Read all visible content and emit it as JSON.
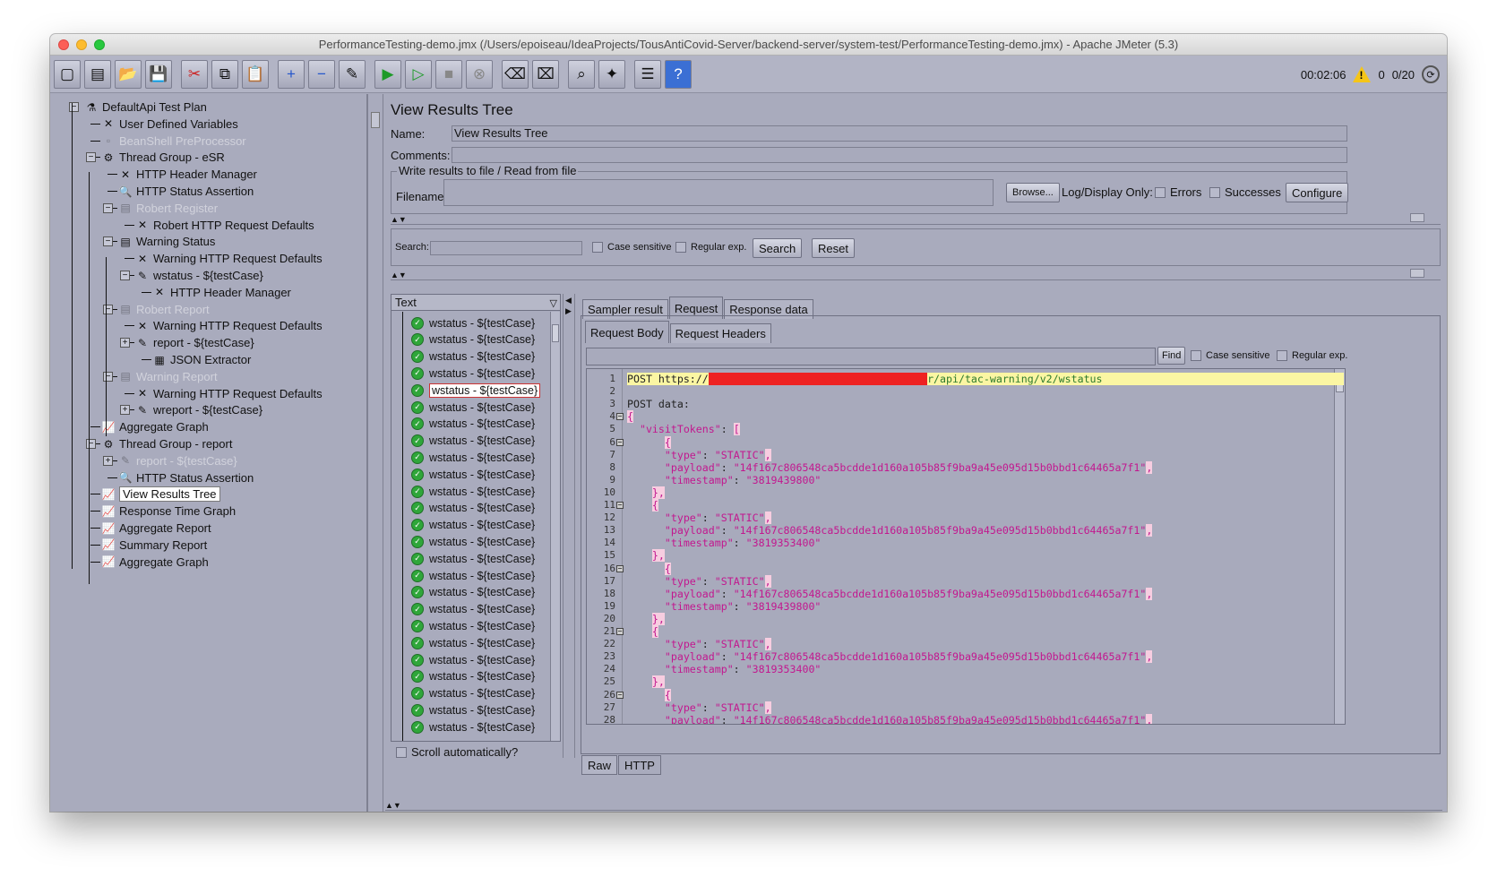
{
  "window": {
    "title": "PerformanceTesting-demo.jmx (/Users/epoiseau/IdeaProjects/TousAntiCovid-Server/backend-server/system-test/PerformanceTesting-demo.jmx) - Apache JMeter (5.3)"
  },
  "toolbar": {
    "elapsed": "00:02:06",
    "errors": "0",
    "threads": "0/20",
    "buttons": [
      "new-icon",
      "templates-icon",
      "open-icon",
      "save-icon",
      "cut-icon",
      "copy-icon",
      "paste-icon",
      "expand-icon",
      "collapse-icon",
      "toggle-icon",
      "start-icon",
      "start-no-pause-icon",
      "stop-icon",
      "shutdown-icon",
      "clear-icon",
      "clear-all-icon",
      "search-icon",
      "reset-search-icon",
      "function-helper-icon",
      "help-icon"
    ]
  },
  "tree": {
    "items": [
      {
        "label": "DefaultApi Test Plan",
        "icon": "testplan-icon",
        "disabled": false
      },
      {
        "label": "User Defined Variables",
        "icon": "config-icon",
        "disabled": false
      },
      {
        "label": "BeanShell PreProcessor",
        "icon": "preprocessor-icon",
        "disabled": true
      },
      {
        "label": "Thread Group - eSR",
        "icon": "gear-icon",
        "disabled": false
      },
      {
        "label": "HTTP Header Manager",
        "icon": "config-icon",
        "disabled": false
      },
      {
        "label": "HTTP Status Assertion",
        "icon": "assertion-icon",
        "disabled": false
      },
      {
        "label": "Robert Register",
        "icon": "controller-icon",
        "disabled": true
      },
      {
        "label": "Robert HTTP Request Defaults",
        "icon": "config-icon",
        "disabled": false
      },
      {
        "label": "Warning Status",
        "icon": "controller-icon",
        "disabled": false
      },
      {
        "label": "Warning HTTP Request Defaults",
        "icon": "config-icon",
        "disabled": false
      },
      {
        "label": "wstatus - ${testCase}",
        "icon": "sampler-icon",
        "disabled": false
      },
      {
        "label": "HTTP Header Manager",
        "icon": "config-icon",
        "disabled": false
      },
      {
        "label": "Robert Report",
        "icon": "controller-icon",
        "disabled": true
      },
      {
        "label": "Warning HTTP Request Defaults",
        "icon": "config-icon",
        "disabled": false
      },
      {
        "label": "report - ${testCase}",
        "icon": "sampler-icon",
        "disabled": false
      },
      {
        "label": "JSON Extractor",
        "icon": "extractor-icon",
        "disabled": false
      },
      {
        "label": "Warning Report",
        "icon": "controller-icon",
        "disabled": true
      },
      {
        "label": "Warning HTTP Request Defaults",
        "icon": "config-icon",
        "disabled": false
      },
      {
        "label": "wreport - ${testCase}",
        "icon": "sampler-icon",
        "disabled": false
      },
      {
        "label": "Aggregate Graph",
        "icon": "listener-icon",
        "disabled": false
      },
      {
        "label": "Thread Group - report",
        "icon": "gear-icon",
        "disabled": false
      },
      {
        "label": "report - ${testCase}",
        "icon": "sampler-icon",
        "disabled": true
      },
      {
        "label": "HTTP Status Assertion",
        "icon": "assertion-icon",
        "disabled": false
      },
      {
        "label": "View Results Tree",
        "icon": "listener-icon",
        "disabled": false,
        "selected": true
      },
      {
        "label": "Response Time Graph",
        "icon": "listener-icon",
        "disabled": false
      },
      {
        "label": "Aggregate Report",
        "icon": "listener-icon",
        "disabled": false
      },
      {
        "label": "Summary Report",
        "icon": "listener-icon",
        "disabled": false
      },
      {
        "label": "Aggregate Graph",
        "icon": "listener-icon",
        "disabled": false
      }
    ]
  },
  "panel": {
    "title": "View Results Tree",
    "name_label": "Name:",
    "name_value": "View Results Tree",
    "comments_label": "Comments:",
    "comments_value": "",
    "file_group_label": "Write results to file / Read from file",
    "filename_label": "Filename",
    "filename_value": "",
    "browse_label": "Browse...",
    "log_display_label": "Log/Display Only:",
    "errors_label": "Errors",
    "successes_label": "Successes",
    "configure_label": "Configure",
    "search_label": "Search:",
    "search_value": "",
    "case_sensitive_label": "Case sensitive",
    "regex_label": "Regular exp.",
    "search_button": "Search",
    "reset_button": "Reset"
  },
  "results": {
    "header": "Text",
    "item_label": "wstatus - ${testCase}",
    "count": 25,
    "selected_index": 4,
    "scroll_auto_label": "Scroll automatically?"
  },
  "tabs": {
    "main": [
      "Sampler result",
      "Request",
      "Response data"
    ],
    "main_active": "Request",
    "sub": [
      "Request Body",
      "Request Headers"
    ],
    "sub_active": "Request Body",
    "bottom": [
      "Raw",
      "HTTP"
    ],
    "bottom_active": "HTTP"
  },
  "request": {
    "find_button": "Find",
    "case_sensitive_label": "Case sensitive",
    "regex_label": "Regular exp.",
    "lines": [
      {
        "n": "1",
        "text": "POST https://",
        "redacted": "xxxxxxxxxxxxxxxxxxxxxxxxxxxxxxxxxxx",
        "tail": "r/api/tac-warning/v2/wstatus"
      },
      {
        "n": "2",
        "text": ""
      },
      {
        "n": "3",
        "text": "POST data:"
      },
      {
        "n": "4",
        "text": "{"
      },
      {
        "n": "5",
        "text": "  \"visitTokens\": ["
      },
      {
        "n": "6",
        "text": "      {"
      },
      {
        "n": "7",
        "text": "      \"type\": \"STATIC\","
      },
      {
        "n": "8",
        "text": "      \"payload\": \"14f167c806548ca5bcdde1d160a105b85f9ba9a45e095d15b0bbd1c64465a7f1\","
      },
      {
        "n": "9",
        "text": "      \"timestamp\": \"3819439800\""
      },
      {
        "n": "10",
        "text": "    },"
      },
      {
        "n": "11",
        "text": "    {"
      },
      {
        "n": "12",
        "text": "      \"type\": \"STATIC\","
      },
      {
        "n": "13",
        "text": "      \"payload\": \"14f167c806548ca5bcdde1d160a105b85f9ba9a45e095d15b0bbd1c64465a7f1\","
      },
      {
        "n": "14",
        "text": "      \"timestamp\": \"3819353400\""
      },
      {
        "n": "15",
        "text": "    },"
      },
      {
        "n": "16",
        "text": "      {"
      },
      {
        "n": "17",
        "text": "      \"type\": \"STATIC\","
      },
      {
        "n": "18",
        "text": "      \"payload\": \"14f167c806548ca5bcdde1d160a105b85f9ba9a45e095d15b0bbd1c64465a7f1\","
      },
      {
        "n": "19",
        "text": "      \"timestamp\": \"3819439800\""
      },
      {
        "n": "20",
        "text": "    },"
      },
      {
        "n": "21",
        "text": "    {"
      },
      {
        "n": "22",
        "text": "      \"type\": \"STATIC\","
      },
      {
        "n": "23",
        "text": "      \"payload\": \"14f167c806548ca5bcdde1d160a105b85f9ba9a45e095d15b0bbd1c64465a7f1\","
      },
      {
        "n": "24",
        "text": "      \"timestamp\": \"3819353400\""
      },
      {
        "n": "25",
        "text": "    },"
      },
      {
        "n": "26",
        "text": "      {"
      },
      {
        "n": "27",
        "text": "      \"type\": \"STATIC\","
      },
      {
        "n": "28",
        "text": "      \"payload\": \"14f167c806548ca5bcdde1d160a105b85f9ba9a45e095d15b0bbd1c64465a7f1\","
      }
    ]
  },
  "colors": {
    "background": "#a9abbd",
    "json_key": "#c2188f",
    "highlight_line": "#fbf6a3",
    "success_icon": "#2fa63a"
  }
}
